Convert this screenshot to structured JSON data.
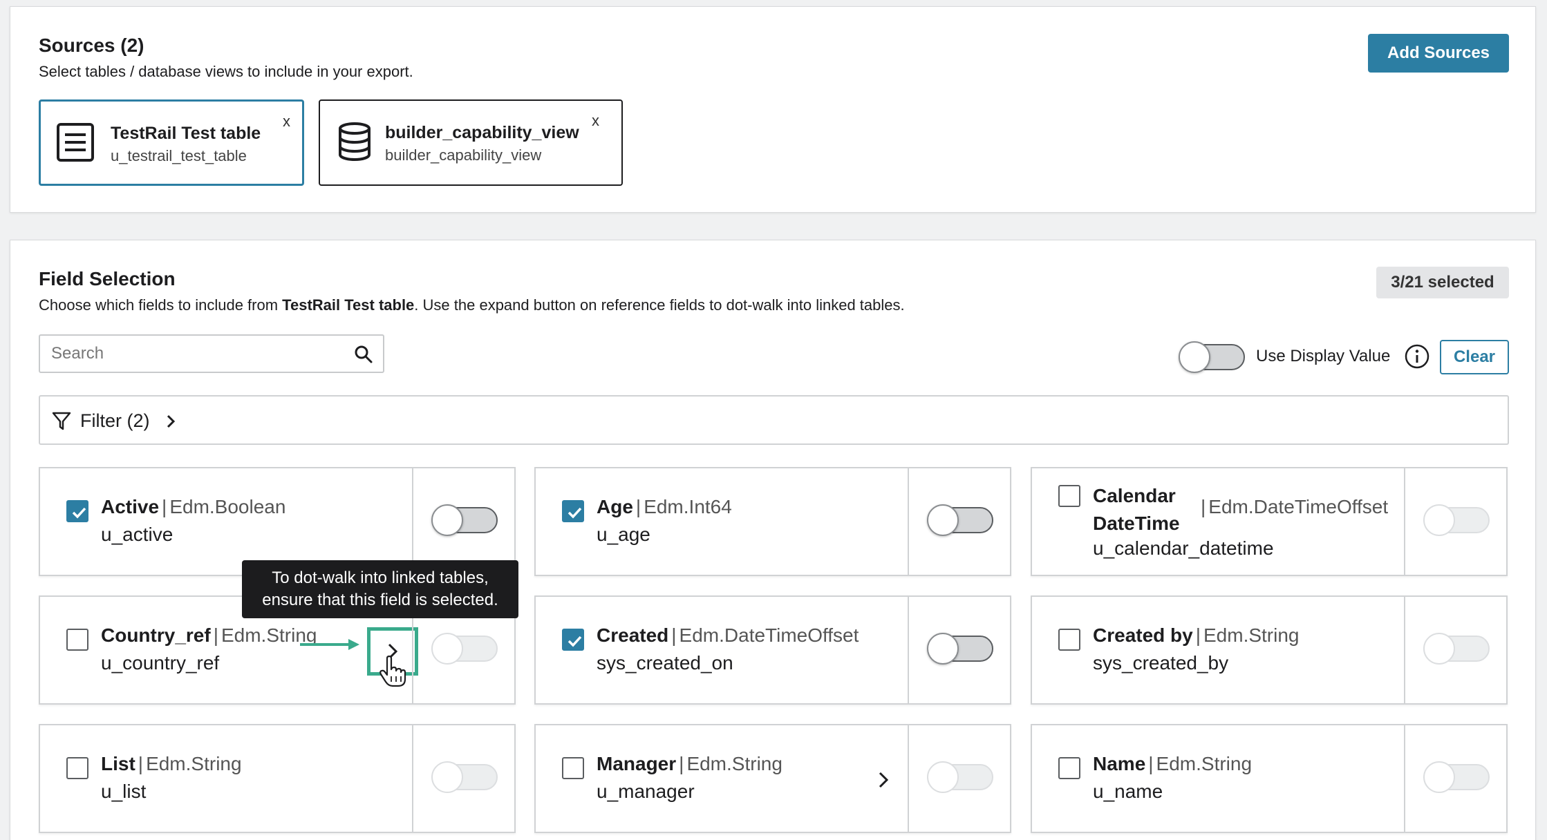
{
  "sources": {
    "title": "Sources (2)",
    "subtitle": "Select tables / database views to include in your export.",
    "add_button": "Add Sources",
    "cards": [
      {
        "name": "TestRail Test table",
        "table": "u_testrail_test_table",
        "close": "x",
        "icon": "table-icon",
        "active": true
      },
      {
        "name": "builder_capability_view",
        "table": "builder_capability_view",
        "close": "x",
        "icon": "database-icon",
        "active": false
      }
    ]
  },
  "fields": {
    "title": "Field Selection",
    "desc_prefix": "Choose which fields to include from ",
    "desc_table": "TestRail Test table",
    "desc_suffix": ". Use the expand button on reference fields to dot-walk into linked tables.",
    "selected_badge": "3/21 selected",
    "search_placeholder": "Search",
    "use_display_value": "Use Display Value",
    "clear_button": "Clear",
    "filter_label": "Filter (2)",
    "tooltip_line1": "To dot-walk into linked tables,",
    "tooltip_line2": "ensure that this field is selected.",
    "separator": "|",
    "items": [
      {
        "label": "Active",
        "type": "Edm.Boolean",
        "name": "u_active",
        "checked": true
      },
      {
        "label": "Age",
        "type": "Edm.Int64",
        "name": "u_age",
        "checked": true
      },
      {
        "label_line1": "Calendar",
        "label_line2": "DateTime",
        "type": "Edm.DateTimeOffset",
        "name": "u_calendar_datetime",
        "checked": false
      },
      {
        "label": "Country_ref",
        "type": "Edm.String",
        "name": "u_country_ref",
        "checked": false
      },
      {
        "label": "Created",
        "type": "Edm.DateTimeOffset",
        "name": "sys_created_on",
        "checked": true
      },
      {
        "label": "Created by",
        "type": "Edm.String",
        "name": "sys_created_by",
        "checked": false
      },
      {
        "label": "List",
        "type": "Edm.String",
        "name": "u_list",
        "checked": false
      },
      {
        "label": "Manager",
        "type": "Edm.String",
        "name": "u_manager",
        "checked": false
      },
      {
        "label": "Name",
        "type": "Edm.String",
        "name": "u_name",
        "checked": false
      }
    ]
  },
  "colors": {
    "accent": "#2c7ea3",
    "highlight": "#3aaa8c",
    "tooltip_bg": "#1c1c1e"
  }
}
